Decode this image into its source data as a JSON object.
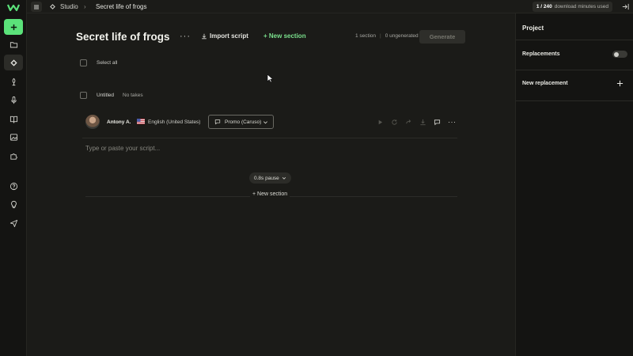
{
  "topbar": {
    "breadcrumb_root": "Studio",
    "breadcrumb_sep": "›",
    "breadcrumb_title": "Secret life of frogs",
    "usage_count": "1 / 240",
    "usage_text": "download minutes used"
  },
  "project": {
    "title": "Secret life of frogs",
    "more": "···",
    "import_label": "Import script",
    "new_section_label": "+ New section",
    "sections_count": "1 section",
    "separator": "|",
    "ungenerated": "0 ungenerated",
    "generate_label": "Generate"
  },
  "list": {
    "select_all": "Select all",
    "chapter_name": "Untitled",
    "chapter_status": "No takes"
  },
  "paragraph": {
    "voice_name": "Antony A.",
    "language": "English (United States)",
    "model": "Promo (Caruso)",
    "more": "···",
    "script_placeholder": "Type or paste your script...",
    "pause_label": "0.8s pause",
    "new_section_label": "+ New section"
  },
  "sidebar": {
    "icons": [
      "add-icon",
      "folder-icon",
      "studio-icon",
      "mic-icon",
      "microphone-icon",
      "book-icon",
      "image-icon",
      "puzzle-icon",
      "help-icon",
      "bulb-icon",
      "send-icon"
    ]
  },
  "right_panel": {
    "title": "Project",
    "replacements_label": "Replacements",
    "replacements_enabled": false,
    "new_replacement_label": "New replacement"
  },
  "colors": {
    "accent": "#5be27a",
    "background": "#1b1b18",
    "panel": "#141412"
  }
}
